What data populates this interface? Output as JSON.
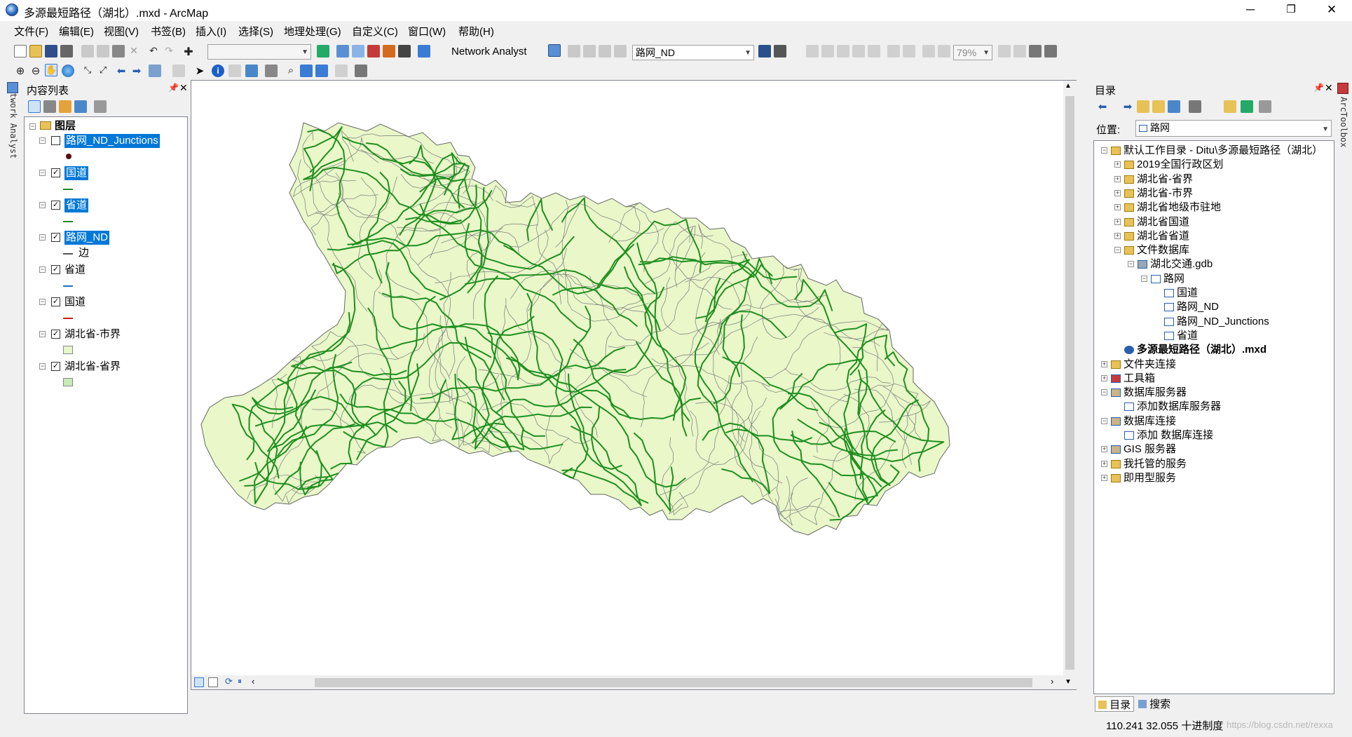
{
  "window": {
    "title": "多源最短路径（湖北）.mxd - ArcMap",
    "minimize": "─",
    "maximize": "❐",
    "close": "✕"
  },
  "menu": [
    "文件(F)",
    "编辑(E)",
    "视图(V)",
    "书签(B)",
    "插入(I)",
    "选择(S)",
    "地理处理(G)",
    "自定义(C)",
    "窗口(W)",
    "帮助(H)"
  ],
  "toolbar": {
    "network_analyst_label": "Network Analyst",
    "network_dataset": "路网_ND",
    "zoom_level": "79%"
  },
  "toc": {
    "title": "内容列表",
    "left_tab": "Network Analyst",
    "root": "图层",
    "layers": [
      {
        "name": "路网_ND_Junctions",
        "checked": false,
        "selected": true,
        "legend": "dot",
        "color": "#5a1010",
        "legend_label": ""
      },
      {
        "name": "国道",
        "checked": true,
        "selected": true,
        "legend": "line",
        "color": "#1e8f1e",
        "legend_label": ""
      },
      {
        "name": "省道",
        "checked": true,
        "selected": true,
        "legend": "line",
        "color": "#1e8f1e",
        "legend_label": ""
      },
      {
        "name": "路网_ND",
        "checked": true,
        "selected": true,
        "legend": "line",
        "color": "#555555",
        "legend_label": "边"
      },
      {
        "name": "省道",
        "checked": true,
        "selected": false,
        "legend": "line",
        "color": "#1a6fc4",
        "legend_label": ""
      },
      {
        "name": "国道",
        "checked": true,
        "selected": false,
        "legend": "line",
        "color": "#c81e1e",
        "legend_label": ""
      },
      {
        "name": "湖北省-市界",
        "checked": true,
        "selected": false,
        "legend": "fill",
        "color": "#e9f7c9",
        "legend_label": ""
      },
      {
        "name": "湖北省-省界",
        "checked": true,
        "selected": false,
        "legend": "fill",
        "color": "#c7ecb8",
        "legend_label": ""
      }
    ]
  },
  "catalog": {
    "title": "目录",
    "location_label": "位置:",
    "location_value": "路网",
    "right_tab": "ArcToolbox",
    "items": [
      {
        "label": "默认工作目录 - Ditu\\多源最短路径（湖北）",
        "level": 0,
        "exp": "-",
        "icon": "home",
        "bold": false
      },
      {
        "label": "2019全国行政区划",
        "level": 1,
        "exp": "+",
        "icon": "folder",
        "bold": false
      },
      {
        "label": "湖北省-省界",
        "level": 1,
        "exp": "+",
        "icon": "folder",
        "bold": false
      },
      {
        "label": "湖北省-市界",
        "level": 1,
        "exp": "+",
        "icon": "folder",
        "bold": false
      },
      {
        "label": "湖北省地级市驻地",
        "level": 1,
        "exp": "+",
        "icon": "folder",
        "bold": false
      },
      {
        "label": "湖北省国道",
        "level": 1,
        "exp": "+",
        "icon": "folder",
        "bold": false
      },
      {
        "label": "湖北省省道",
        "level": 1,
        "exp": "+",
        "icon": "folder",
        "bold": false
      },
      {
        "label": "文件数据库",
        "level": 1,
        "exp": "-",
        "icon": "folder",
        "bold": false
      },
      {
        "label": "湖北交通.gdb",
        "level": 2,
        "exp": "-",
        "icon": "gdb",
        "bold": false
      },
      {
        "label": "路网",
        "level": 3,
        "exp": "-",
        "icon": "dataset",
        "bold": false
      },
      {
        "label": "国道",
        "level": 4,
        "exp": "",
        "icon": "fc",
        "bold": false
      },
      {
        "label": "路网_ND",
        "level": 4,
        "exp": "",
        "icon": "nd",
        "bold": false
      },
      {
        "label": "路网_ND_Junctions",
        "level": 4,
        "exp": "",
        "icon": "fc",
        "bold": false
      },
      {
        "label": "省道",
        "level": 4,
        "exp": "",
        "icon": "fc",
        "bold": false
      },
      {
        "label": "多源最短路径（湖北）.mxd",
        "level": 1,
        "exp": "",
        "icon": "mxd",
        "bold": true
      },
      {
        "label": "文件夹连接",
        "level": 0,
        "exp": "+",
        "icon": "folder",
        "bold": false
      },
      {
        "label": "工具箱",
        "level": 0,
        "exp": "+",
        "icon": "toolbox",
        "bold": false
      },
      {
        "label": "数据库服务器",
        "level": 0,
        "exp": "-",
        "icon": "server",
        "bold": false
      },
      {
        "label": "添加数据库服务器",
        "level": 1,
        "exp": "",
        "icon": "add",
        "bold": false
      },
      {
        "label": "数据库连接",
        "level": 0,
        "exp": "-",
        "icon": "server",
        "bold": false
      },
      {
        "label": "添加 数据库连接",
        "level": 1,
        "exp": "",
        "icon": "add",
        "bold": false
      },
      {
        "label": "GIS 服务器",
        "level": 0,
        "exp": "+",
        "icon": "server",
        "bold": false
      },
      {
        "label": "我托管的服务",
        "level": 0,
        "exp": "+",
        "icon": "folder",
        "bold": false
      },
      {
        "label": "即用型服务",
        "level": 0,
        "exp": "+",
        "icon": "folder",
        "bold": false
      }
    ],
    "bottom_tabs": [
      "目录",
      "搜索"
    ]
  },
  "status": {
    "coords": "110.241  32.055 十进制度",
    "watermark": "https://blog.csdn.net/rexxa"
  },
  "colors": {
    "city_fill": "#e9f7c9",
    "city_stroke": "#7a7a7a",
    "road": "#1e8f1e",
    "selection": "#0078d7"
  }
}
